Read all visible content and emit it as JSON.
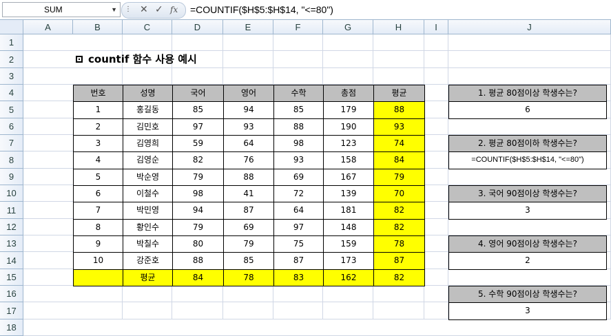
{
  "formula_bar": {
    "name_box": "SUM",
    "cancel_glyph": "✕",
    "enter_glyph": "✓",
    "fx_glyph": "fx",
    "formula": "=COUNTIF($H$5:$H$14, \"<=80\")"
  },
  "columns": [
    "A",
    "B",
    "C",
    "D",
    "E",
    "F",
    "G",
    "H",
    "I",
    "J"
  ],
  "rows": [
    "1",
    "2",
    "3",
    "4",
    "5",
    "6",
    "7",
    "8",
    "9",
    "10",
    "11",
    "12",
    "13",
    "14",
    "15",
    "16",
    "17",
    "18"
  ],
  "title": "countif 함수 사용 예시",
  "table": {
    "headers": [
      "번호",
      "성명",
      "국어",
      "영어",
      "수학",
      "총점",
      "평균"
    ],
    "rows": [
      [
        "1",
        "홍길동",
        "85",
        "94",
        "85",
        "179",
        "88"
      ],
      [
        "2",
        "김민호",
        "97",
        "93",
        "88",
        "190",
        "93"
      ],
      [
        "3",
        "김영희",
        "59",
        "64",
        "98",
        "123",
        "74"
      ],
      [
        "4",
        "김영순",
        "82",
        "76",
        "93",
        "158",
        "84"
      ],
      [
        "5",
        "박순영",
        "79",
        "88",
        "69",
        "167",
        "79"
      ],
      [
        "6",
        "이철수",
        "98",
        "41",
        "72",
        "139",
        "70"
      ],
      [
        "7",
        "박민영",
        "94",
        "87",
        "64",
        "181",
        "82"
      ],
      [
        "8",
        "황인수",
        "79",
        "69",
        "97",
        "148",
        "82"
      ],
      [
        "9",
        "박칠수",
        "80",
        "79",
        "75",
        "159",
        "78"
      ],
      [
        "10",
        "강준호",
        "88",
        "85",
        "87",
        "173",
        "87"
      ]
    ],
    "avg_row": [
      "",
      "평균",
      "84",
      "78",
      "83",
      "162",
      "82"
    ]
  },
  "questions": [
    {
      "q": "1. 평균 80점이상 학생수는?",
      "a": "6"
    },
    {
      "q": "2. 평균 80점이하 학생수는?",
      "a": "=COUNTIF($H$5:$H$14, \"<=80\")"
    },
    {
      "q": "3. 국어 90점이상 학생수는?",
      "a": "3"
    },
    {
      "q": "4. 영어 90점이상 학생수는?",
      "a": "2"
    },
    {
      "q": "5. 수학 90점이상 학생수는?",
      "a": "3"
    }
  ],
  "colors": {
    "header_gray": "#bfbfbf",
    "highlight": "#ffff00",
    "gridline": "#d0d7e5"
  }
}
